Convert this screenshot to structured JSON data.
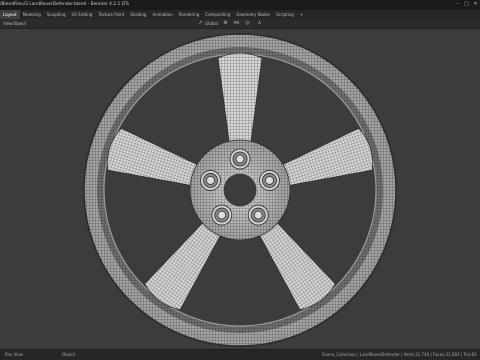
{
  "titlebar": {
    "title": "/BlendFiles/3 LandRoverDefender.blend - Blender 4.2.1 LTS"
  },
  "menubar": {
    "tabs": [
      "Layout",
      "Modeling",
      "Sculpting",
      "UV Editing",
      "Texture Paint",
      "Shading",
      "Animation",
      "Rendering",
      "Compositing",
      "Geometry Nodes",
      "Scripting",
      "+"
    ],
    "active_index": 0,
    "scene": "Scene"
  },
  "toolbar": {
    "view_label": "View",
    "object_label": "Object",
    "orientation": "Global"
  },
  "statusbar": {
    "left": "Pan View",
    "middle": "Object",
    "right": "Scene_Collection | LandRoverDefender | Verts:31,740 | Faces:31,583 | Tris:63"
  },
  "wheel": {
    "spokes": 5,
    "lug_nuts": 5
  }
}
